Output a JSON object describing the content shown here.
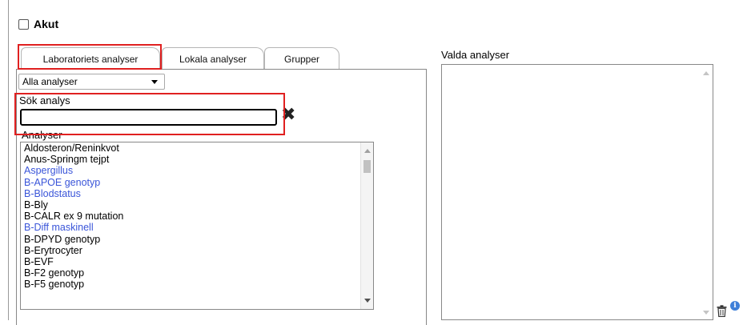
{
  "akut": {
    "label": "Akut",
    "checked": false
  },
  "tabs": [
    {
      "label": "Laboratoriets analyser",
      "active": true
    },
    {
      "label": "Lokala analyser",
      "active": false
    },
    {
      "label": "Grupper",
      "active": false
    }
  ],
  "filter": {
    "selected": "Alla analyser"
  },
  "search": {
    "label": "Sök analys",
    "value": "",
    "clear_icon": "close-icon"
  },
  "analyser": {
    "label": "Analyser",
    "items": [
      {
        "label": "Aldosteron/Reninkvot",
        "link": false
      },
      {
        "label": "Anus-Springm tejpt",
        "link": false
      },
      {
        "label": "Aspergillus",
        "link": true
      },
      {
        "label": "B-APOE genotyp",
        "link": true
      },
      {
        "label": "B-Blodstatus",
        "link": true
      },
      {
        "label": "B-Bly",
        "link": false
      },
      {
        "label": "B-CALR ex 9 mutation",
        "link": false
      },
      {
        "label": "B-Diff maskinell",
        "link": true
      },
      {
        "label": "B-DPYD genotyp",
        "link": false
      },
      {
        "label": "B-Erytrocyter",
        "link": false
      },
      {
        "label": "B-EVF",
        "link": false
      },
      {
        "label": "B-F2 genotyp",
        "link": false
      },
      {
        "label": "B-F5 genotyp",
        "link": false
      }
    ]
  },
  "valda": {
    "label": "Valda analyser"
  },
  "icons": {
    "trash": "trash-icon",
    "info": "info-icon"
  },
  "colors": {
    "link": "#3a55d9",
    "highlight": "#e02020",
    "info": "#3f7fd8"
  }
}
